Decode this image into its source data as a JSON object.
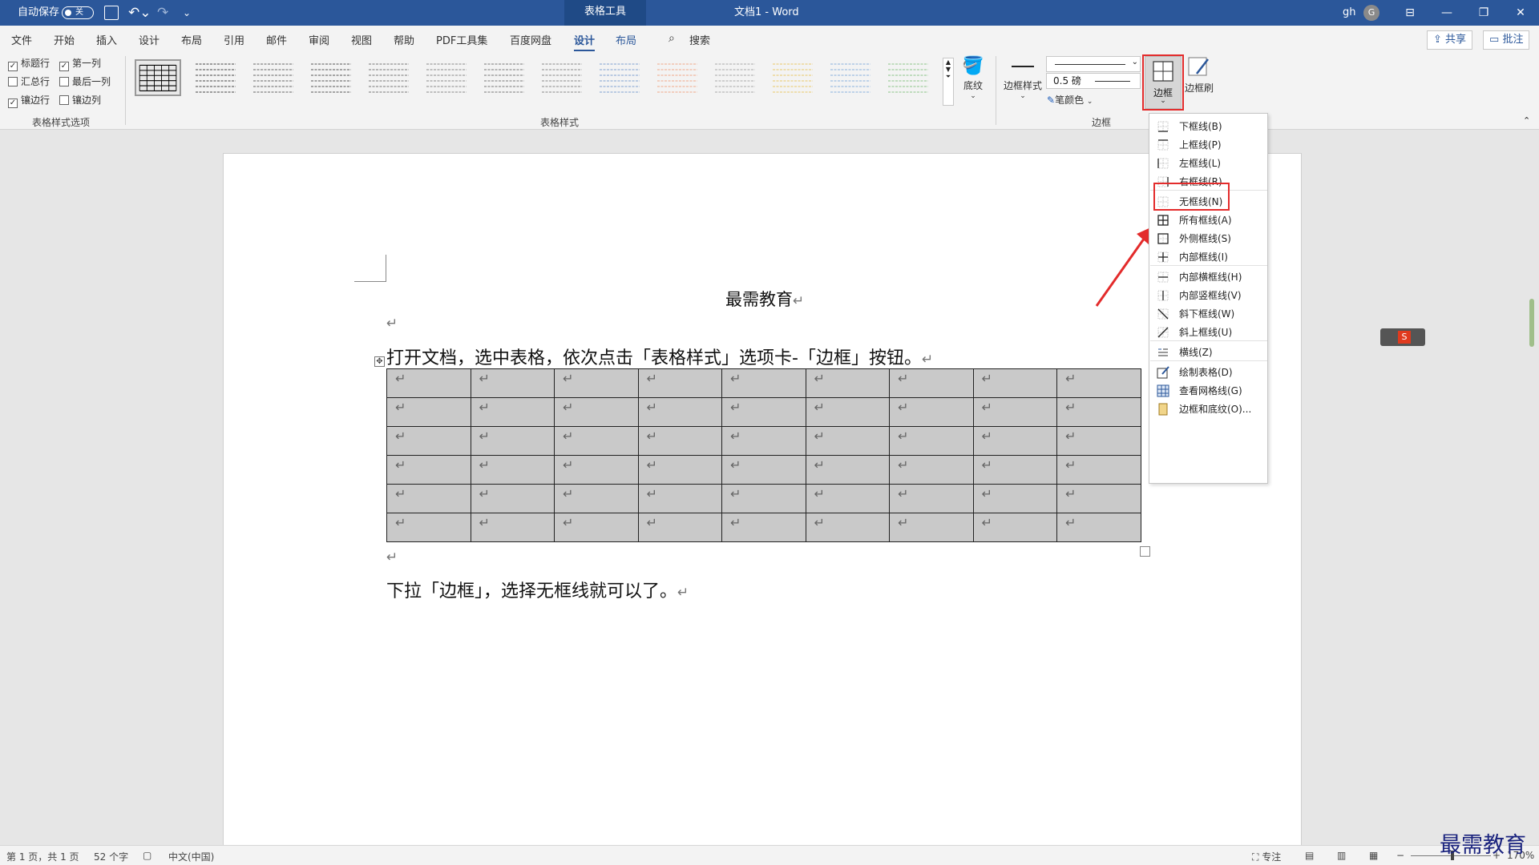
{
  "titlebar": {
    "autosave_label": "自动保存",
    "autosave_state": "关",
    "context_tab": "表格工具",
    "doc_title": "文档1  -  Word",
    "user_name": "gh",
    "avatar_initial": "G"
  },
  "menu": {
    "items": [
      "文件",
      "开始",
      "插入",
      "设计",
      "布局",
      "引用",
      "邮件",
      "审阅",
      "视图",
      "帮助",
      "PDF工具集",
      "百度网盘",
      "设计",
      "布局"
    ],
    "active": "设计",
    "search": "搜索",
    "share": "共享",
    "comment": "批注"
  },
  "ribbon": {
    "options": {
      "header_row": "标题行",
      "first_col": "第一列",
      "total_row": "汇总行",
      "last_col": "最后一列",
      "banded_rows": "镶边行",
      "banded_cols": "镶边列",
      "group_label": "表格样式选项"
    },
    "styles_group_label": "表格样式",
    "shading": "底纹",
    "border_styles": "边框样式",
    "pen_weight": "0.5 磅",
    "pen_color": "笔颜色",
    "borders": "边框",
    "border_painter": "边框刷",
    "borders_group_label": "边框"
  },
  "document": {
    "title": "最需教育",
    "paragraph1": "打开文档，选中表格，依次点击「表格样式」选项卡-「边框」按钮。",
    "paragraph2": "下拉「边框」，选择无框线就可以了。",
    "para_mark": "↵",
    "table": {
      "rows": 6,
      "cols": 9
    }
  },
  "dropdown": {
    "items": [
      "下框线(B)",
      "上框线(P)",
      "左框线(L)",
      "右框线(R)",
      "无框线(N)",
      "所有框线(A)",
      "外侧框线(S)",
      "内部框线(I)",
      "内部横框线(H)",
      "内部竖框线(V)",
      "斜下框线(W)",
      "斜上框线(U)",
      "横线(Z)",
      "绘制表格(D)",
      "查看网格线(G)",
      "边框和底纹(O)..."
    ],
    "highlighted": "无框线(N)"
  },
  "statusbar": {
    "page": "第 1 页，共 1 页",
    "words": "52 个字",
    "language": "中文(中国)",
    "focus": "专注",
    "zoom": "170%"
  },
  "watermark": "最需教育",
  "colors": {
    "titlebar": "#2b579a",
    "highlight": "#e32b2b",
    "table_shading": "#c9c9c9"
  }
}
